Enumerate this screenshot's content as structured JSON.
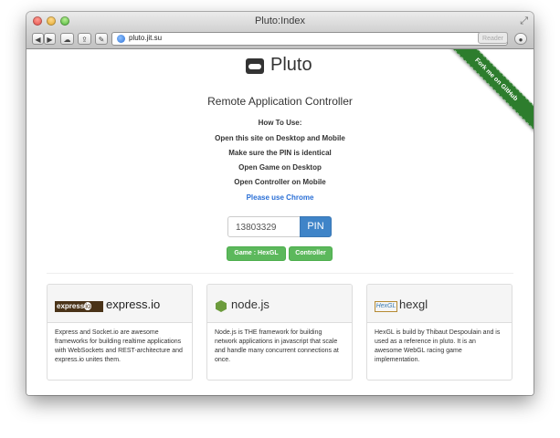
{
  "window": {
    "title": "Pluto:Index",
    "url": "pluto.jit.su",
    "reader_label": "Reader"
  },
  "toolbar": {
    "back_glyph": "◀",
    "forward_glyph": "▶",
    "icons": [
      "cloud-icon",
      "share-icon",
      "wrench-icon",
      "download-icon"
    ]
  },
  "ribbon": {
    "text": "Fork me on GitHub"
  },
  "header": {
    "logo_text": "Pluto",
    "subtitle": "Remote Application Controller"
  },
  "howto": {
    "title": "How To Use:",
    "steps": [
      "Open this site on Desktop and Mobile",
      "Make sure the PIN is identical",
      "Open Game on Desktop",
      "Open Controller on Mobile"
    ],
    "note": "Please use Chrome"
  },
  "pin": {
    "value": "13803329",
    "button_label": "PIN"
  },
  "buttons": {
    "game": "Game : HexGL",
    "controller": "Controller"
  },
  "cards": [
    {
      "badge": "express",
      "badge_io": "io",
      "title": "express.io",
      "body": "Express and Socket.io are awesome frameworks for building realtime applications with WebSockets and REST-architecture and express.io unites them."
    },
    {
      "title": "node.js",
      "body": "Node.js is THE framework for building network applications in javascript that scale and handle many concurrent connections at once."
    },
    {
      "badge": "HexGL",
      "title": "hexgl",
      "body": "HexGL is build by Thibaut Despoulain and is used as a reference in pluto. It is an awesome WebGL racing game implementation."
    }
  ],
  "colors": {
    "link": "#2a6fd6",
    "pin_button": "#3f84c8",
    "success_button": "#5cb85c",
    "ribbon": "#2d7d2d"
  }
}
